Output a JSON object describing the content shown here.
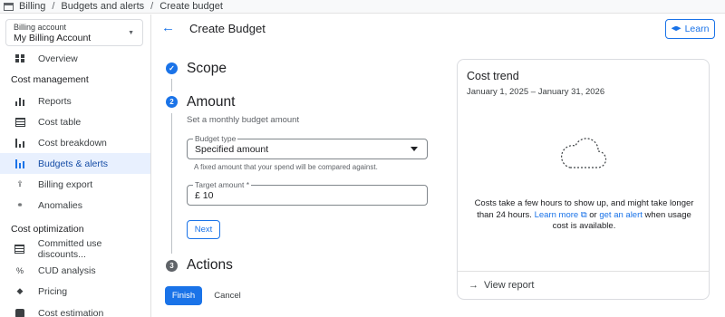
{
  "breadcrumb": {
    "items": [
      "Billing",
      "Budgets and alerts",
      "Create budget"
    ]
  },
  "account": {
    "label": "Billing account",
    "value": "My Billing Account"
  },
  "sidebar": {
    "overview": "Overview",
    "section_cost_management": "Cost management",
    "reports": "Reports",
    "cost_table": "Cost table",
    "cost_breakdown": "Cost breakdown",
    "budgets_alerts": "Budgets & alerts",
    "billing_export": "Billing export",
    "anomalies": "Anomalies",
    "section_cost_optimization": "Cost optimization",
    "committed_use": "Committed use discounts...",
    "cud_analysis": "CUD analysis",
    "pricing": "Pricing",
    "cost_estimation": "Cost estimation"
  },
  "header": {
    "title": "Create Budget",
    "learn_label": "Learn"
  },
  "steps": {
    "scope": {
      "number": "1",
      "title": "Scope"
    },
    "amount": {
      "number": "2",
      "title": "Amount",
      "subtitle": "Set a monthly budget amount"
    },
    "actions": {
      "number": "3",
      "title": "Actions"
    }
  },
  "form": {
    "budget_type_label": "Budget type",
    "budget_type_value": "Specified amount",
    "budget_type_hint": "A fixed amount that your spend will be compared against.",
    "target_amount_label": "Target amount *",
    "currency_symbol": "£",
    "target_amount_value": "10",
    "next_label": "Next",
    "finish_label": "Finish",
    "cancel_label": "Cancel"
  },
  "cost_trend": {
    "title": "Cost trend",
    "date_range": "January 1, 2025 – January 31, 2026",
    "message_1": "Costs take a few hours to show up, and might take longer than 24 hours.",
    "learn_more": "Learn more",
    "message_or": "or",
    "get_alert": "get an alert",
    "message_2": "when usage cost is available.",
    "view_report": "View report"
  },
  "colors": {
    "accent": "#1a73e8",
    "active_bg": "#e8f0fe"
  }
}
